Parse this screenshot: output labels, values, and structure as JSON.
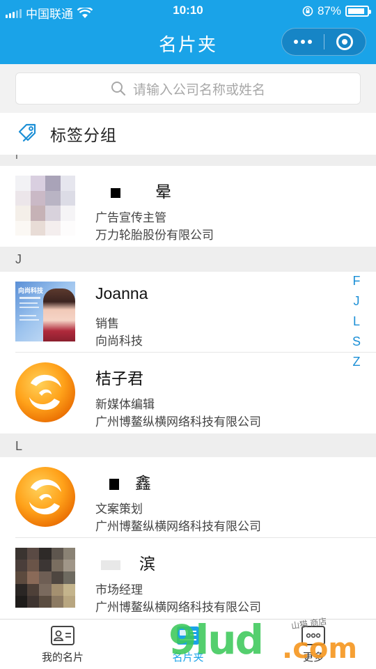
{
  "status_bar": {
    "carrier": "中国联通",
    "time": "10:10",
    "battery_percent": "87%",
    "battery_level": 0.87
  },
  "nav": {
    "title": "名片夹"
  },
  "search": {
    "placeholder": "请输入公司名称或姓名"
  },
  "tag_group": {
    "label": "标签分组"
  },
  "sections": {
    "I": "I",
    "J": "J",
    "L": "L"
  },
  "contacts": [
    {
      "name": "　　晕",
      "title": "广告宣传主管",
      "company": "万力轮胎股份有限公司"
    },
    {
      "name": "Joanna",
      "title": "销售",
      "company": "向尚科技",
      "card_text": "向尚科技"
    },
    {
      "name": "桔子君",
      "title": "新媒体编辑",
      "company": "广州博鳌纵横网络科技有限公司"
    },
    {
      "name": "　鑫",
      "title": "文案策划",
      "company": "广州博鳌纵横网络科技有限公司"
    },
    {
      "name": "　滨",
      "title": "市场经理",
      "company": "广州博鳌纵横网络科技有限公司"
    }
  ],
  "alpha_index": [
    "F",
    "J",
    "L",
    "S",
    "Z"
  ],
  "tabs": [
    {
      "label": "我的名片",
      "icon": "id-card-icon"
    },
    {
      "label": "名片夹",
      "icon": "card-holder-icon"
    },
    {
      "label": "更多",
      "icon": "more-icon"
    }
  ],
  "watermark": {
    "main": "9lud",
    "suffix": ".com",
    "small": "山猫 商店"
  },
  "colors": {
    "brand": "#1aa3e8",
    "index_blue": "#1b8fd6"
  }
}
